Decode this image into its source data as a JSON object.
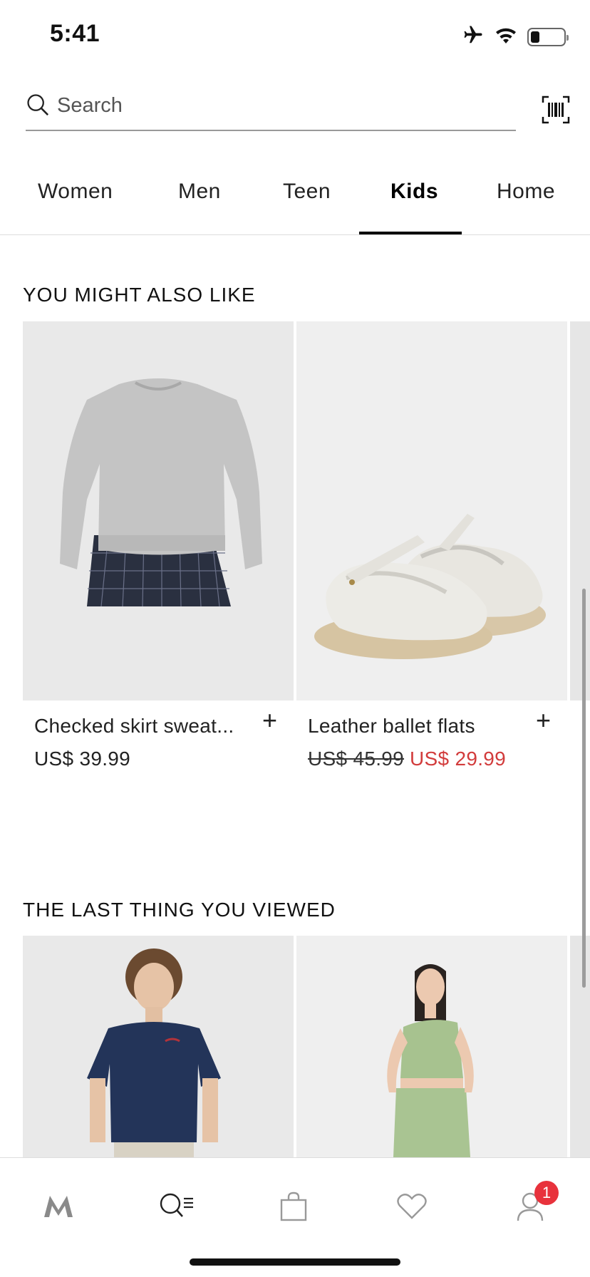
{
  "status_bar": {
    "time": "5:41",
    "icons": [
      "airplane-icon",
      "wifi-icon",
      "battery-icon"
    ]
  },
  "search": {
    "placeholder": "Search",
    "value": ""
  },
  "tabs": [
    {
      "label": "Women",
      "active": false
    },
    {
      "label": "Men",
      "active": false
    },
    {
      "label": "Teen",
      "active": false
    },
    {
      "label": "Kids",
      "active": true
    },
    {
      "label": "Home",
      "active": false
    }
  ],
  "section_recommend": {
    "title": "YOU MIGHT ALSO LIKE",
    "products": [
      {
        "name": "Checked skirt sweat...",
        "price": "US$ 39.99"
      },
      {
        "name": "Leather ballet flats",
        "old_price": "US$ 45.99",
        "sale_price": "US$ 29.99"
      }
    ]
  },
  "section_viewed": {
    "title": "THE LAST THING YOU VIEWED"
  },
  "bottom_nav": {
    "items": [
      "home",
      "search-menu",
      "bag",
      "wishlist",
      "account"
    ],
    "account_badge": "1"
  },
  "colors": {
    "accent": "#000000",
    "sale": "#d23c3c",
    "badge": "#e8323c"
  }
}
